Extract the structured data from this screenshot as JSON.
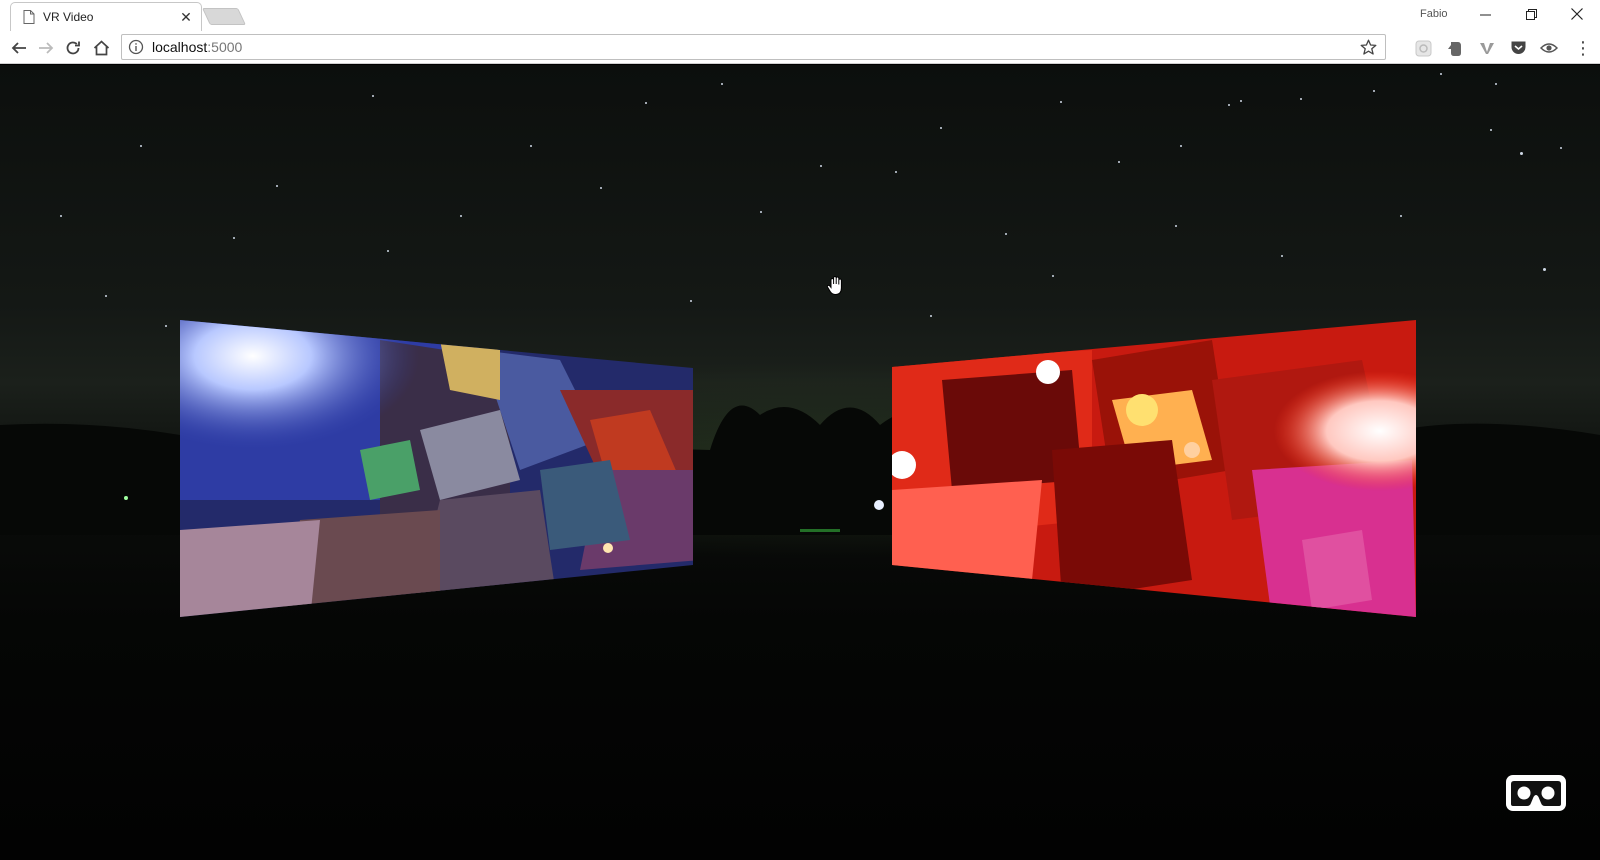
{
  "browser": {
    "tab_title": "VR Video",
    "tab_close_glyph": "✕",
    "profile_name": "Fabio",
    "url_host": "localhost",
    "url_port": ":5000",
    "window_controls": {
      "minimize_glyph": "—",
      "close_glyph": "✕"
    },
    "extensions": [
      "extension-gear-icon",
      "evernote-icon",
      "vimeo-icon",
      "pocket-icon",
      "eye-icon"
    ],
    "menu_glyph": "⋮"
  },
  "scene": {
    "background": "night-sky-360",
    "videos": [
      {
        "name": "left-360-video",
        "palette": [
          "#2a3aa8",
          "#6a4a9a",
          "#b03020",
          "#3a6a8a"
        ]
      },
      {
        "name": "right-360-video",
        "palette": [
          "#e02010",
          "#ff4020",
          "#a01008",
          "#ffd0c0"
        ]
      }
    ],
    "vr_button": "cardboard-vr-icon"
  }
}
